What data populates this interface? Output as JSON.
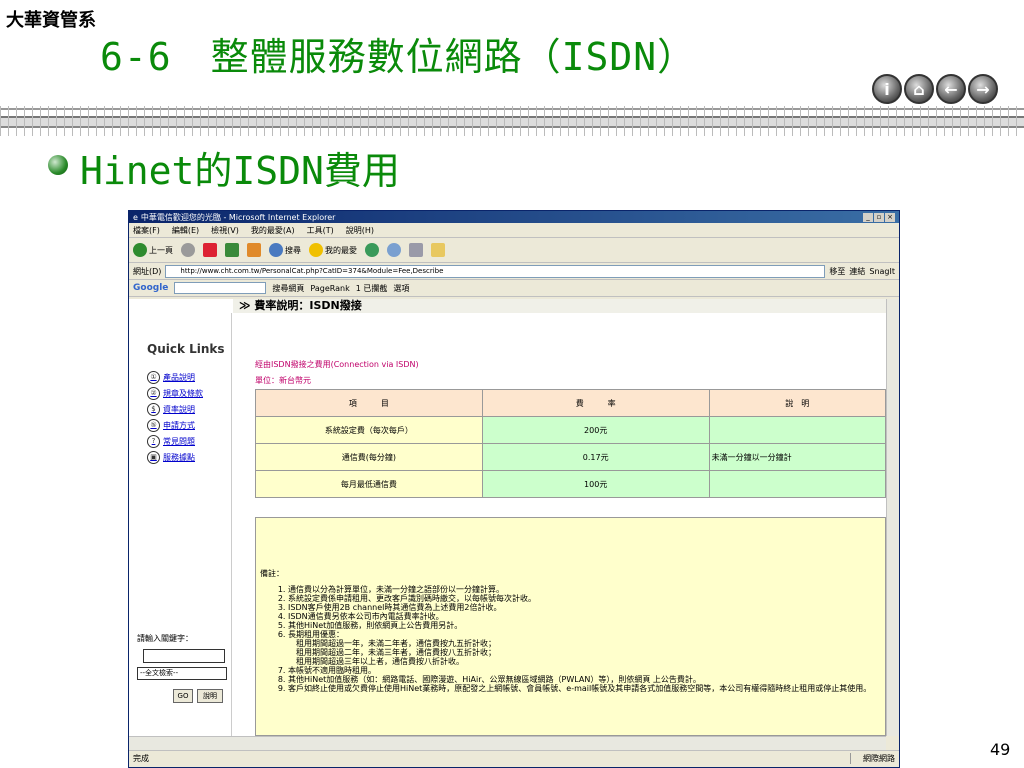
{
  "slide": {
    "department": "大華資管系",
    "title": "6-6　整體服務數位網路（ISDN）",
    "bullet": "Hinet的ISDN費用",
    "page_number": "49",
    "nav_buttons": [
      {
        "icon": "info-icon",
        "glyph": "i"
      },
      {
        "icon": "home-icon",
        "glyph": "⌂"
      },
      {
        "icon": "back-arrow-icon",
        "glyph": "←"
      },
      {
        "icon": "forward-arrow-icon",
        "glyph": "→"
      }
    ]
  },
  "browser": {
    "title": "中華電信歡迎您的光臨 - Microsoft Internet Explorer",
    "menu": [
      "檔案(F)",
      "編輯(E)",
      "檢視(V)",
      "我的最愛(A)",
      "工具(T)",
      "說明(H)"
    ],
    "toolbar": {
      "back": "上一頁",
      "search": "搜尋",
      "favorites": "我的最愛"
    },
    "address_label": "網址(D)",
    "address_url": "http://www.cht.com.tw/PersonalCat.php?CatID=374&Module=Fee,Describe",
    "go_label": "移至",
    "links_label": "連結",
    "snagit_label": "SnagIt",
    "google": {
      "logo": "Google",
      "search_web": "搜尋網頁",
      "pagerank": "PageRank",
      "blocked": "1 已攔截",
      "options": "選項"
    },
    "status_text": "完成",
    "status_zone": "網際網路"
  },
  "page": {
    "header": "≫ 費率說明：ISDN撥接",
    "quick_links_title": "Quick Links",
    "quick_links": [
      {
        "num": "①",
        "label": "產品說明"
      },
      {
        "num": "②",
        "label": "規章及條款"
      },
      {
        "num": "$",
        "label": "資率說明"
      },
      {
        "num": "⑤",
        "label": "申請方式"
      },
      {
        "num": "?",
        "label": "常見問題"
      },
      {
        "num": "▣",
        "label": "服務據點"
      }
    ],
    "keyword_label": "請輸入關鍵字：",
    "search_scope": "--全文檢索--",
    "go_button": "GO",
    "explain_button": "說明",
    "subtitle": "經由ISDN撥接之費用(Connection via ISDN)",
    "unit": "單位：新台幣元",
    "table": {
      "headers": [
        "項　　　目",
        "費　　　率",
        "說　明"
      ],
      "rows": [
        [
          "系統設定費（每次每戶）",
          "200元",
          ""
        ],
        [
          "通信費(每分鐘)",
          "0.17元",
          "未滿一分鐘以一分鐘計"
        ],
        [
          "每月最低通信費",
          "100元",
          ""
        ]
      ]
    },
    "notes_label": "備註：",
    "notes": [
      "通信費以分為計算單位，未滿一分鐘之語部份以一分鐘計算。",
      "系統設定費係申請租用、更改客戶識別碼時繳交，以每帳號每次計收。",
      "ISDN客戶使用2B channel時其通信費為上述費用2倍計收。",
      "ISDN通信費另依本公司市內電話費率計收。",
      "其他HiNet加值服務，則依網頁上公告費用另計。",
      "長期租用優惠：",
      "本帳號不適用臨時租用。",
      "其他HiNet加值服務（如：網路電話、國際漫遊、HiAir、公眾無線區域網路（PWLAN）等），則依網頁 上公告費計。",
      "客戶如終止使用或欠費停止使用HiNet業務時，原配發之上網帳號、會員帳號、e-mail帳號及其申請各式加值服務空間等，本公司有權得隨時終止租用或停止其使用。"
    ],
    "discount_lines": [
      "租用期間超過一年，未滿二年者，通信費按九五折計收；",
      "租用期間超過二年，未滿三年者，通信費按八五折計收；",
      "租用期間超過三年以上者，通信費按八折計收。"
    ]
  }
}
